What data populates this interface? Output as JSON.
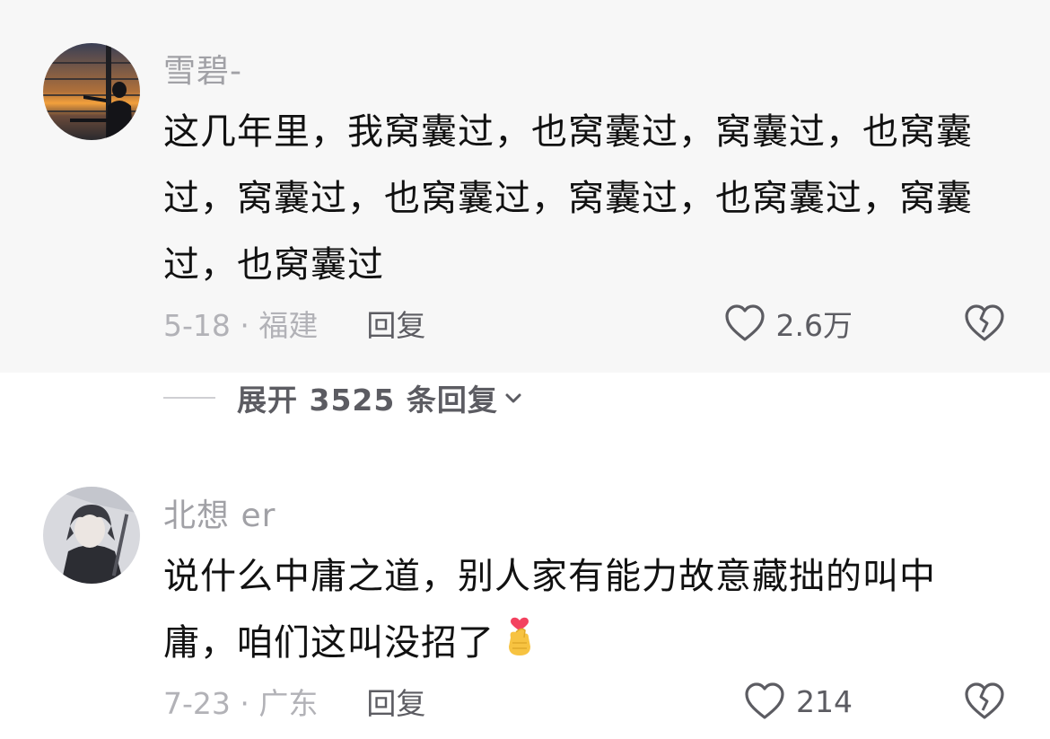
{
  "comments": [
    {
      "username": "雪碧-",
      "text": "这几年里，我窝囊过，也窝囊过，窝囊过，也窝囊过，窝囊过，也窝囊过，窝囊过，也窝囊过，窝囊过，也窝囊过",
      "date_location": "5-18 · 福建",
      "reply_label": "回复",
      "like_count": "2.6万",
      "expand_label": "展开 3525 条回复",
      "avatar_icon": "sunset-window-silhouette-avatar"
    },
    {
      "username": "北想 er",
      "text": "说什么中庸之道，别人家有能力故意藏拙的叫中庸，咱们这叫没招了",
      "emoji_icon": "finger-heart-emoji",
      "date_location": "7-23 · 广东",
      "reply_label": "回复",
      "like_count": "214",
      "avatar_icon": "anime-character-avatar"
    }
  ],
  "colors": {
    "username": "#a1a1a6",
    "body": "#111111",
    "meta": "#b2b2b7",
    "action": "#5c5c62",
    "first_bg": "#f7f7f7"
  }
}
